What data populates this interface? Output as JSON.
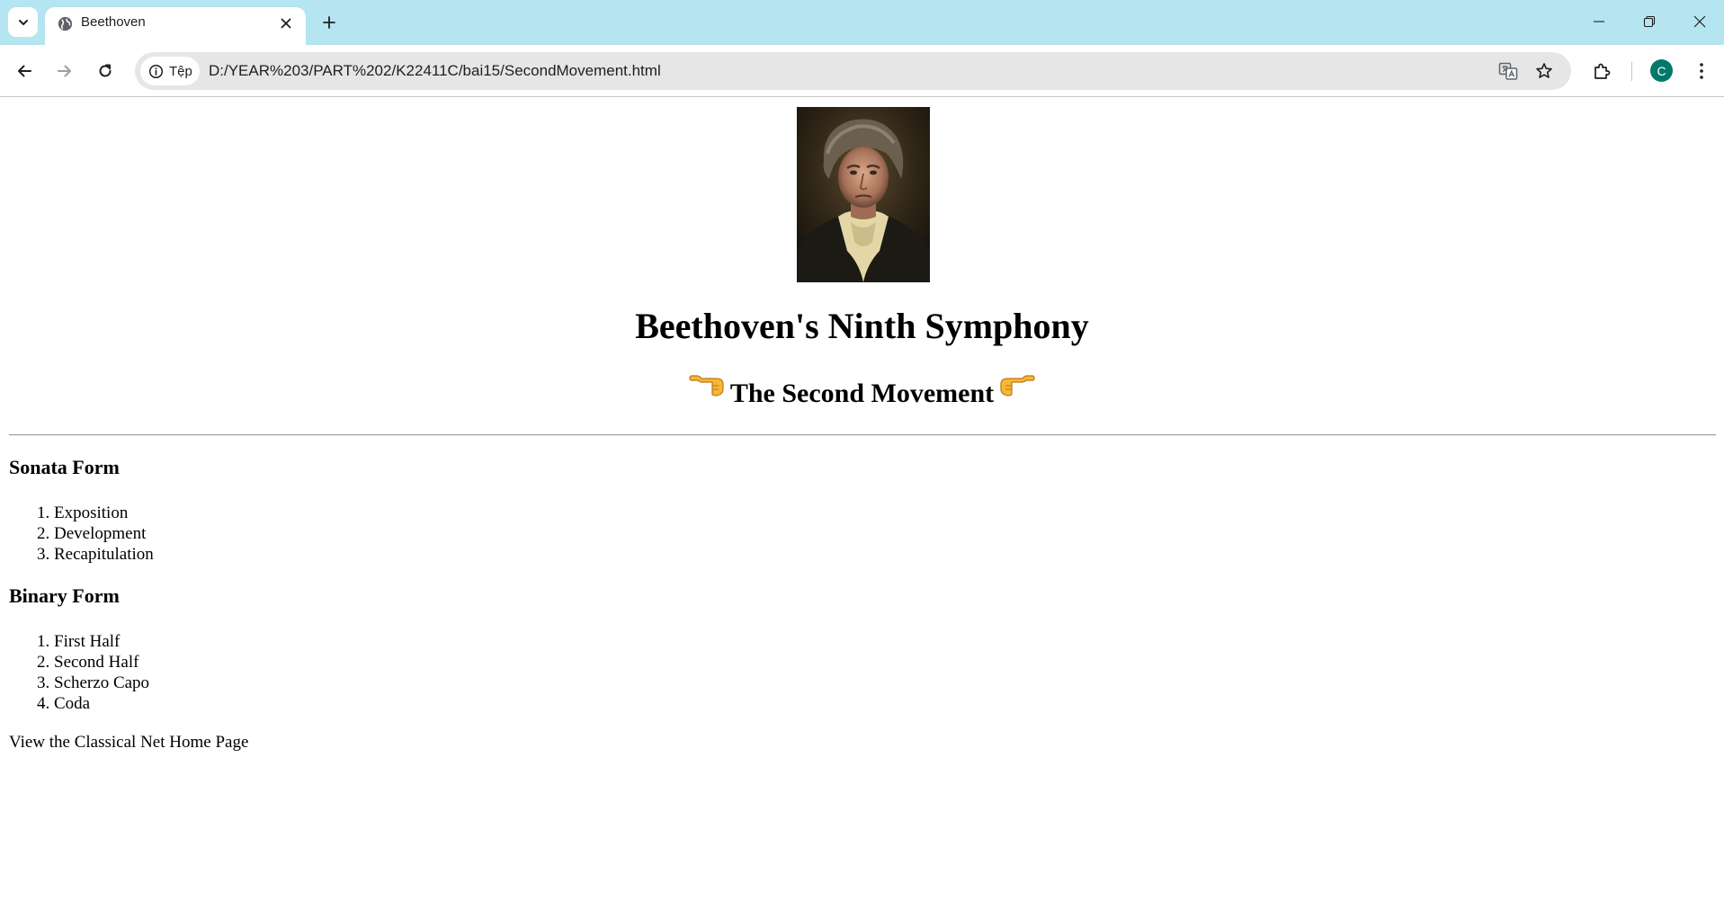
{
  "browser": {
    "tab": {
      "title": "Beethoven"
    },
    "address_bar": {
      "site_chip_label": "Tệp",
      "url": "D:/YEAR%203/PART%202/K22411C/bai15/SecondMovement.html"
    },
    "profile_initial": "C",
    "colors": {
      "tabstrip": "#b4e5f1",
      "omnibox": "#e6e6e6",
      "avatar": "#00796b"
    },
    "icons": {
      "tab_search": "chevron-down-icon",
      "favicon": "globe-icon",
      "tab_close": "close-icon",
      "new_tab": "plus-icon",
      "back": "arrow-left-icon",
      "forward": "arrow-right-icon",
      "reload": "reload-icon",
      "site_info": "info-icon",
      "translate": "translate-icon",
      "bookmark": "star-icon",
      "extensions": "puzzle-icon",
      "menu": "kebab-menu-icon",
      "minimize": "minimize-icon",
      "restore": "restore-icon",
      "close_window": "close-window-icon"
    }
  },
  "page": {
    "title": "Beethoven's Ninth Symphony",
    "subtitle": "The Second Movement",
    "subtitle_left_emoji": "👈",
    "subtitle_right_emoji": "👉",
    "sections": [
      {
        "heading": "Sonata Form",
        "items": [
          "Exposition",
          "Development",
          "Recapitulation"
        ]
      },
      {
        "heading": "Binary Form",
        "items": [
          "First Half",
          "Second Half",
          "Scherzo Capo",
          "Coda"
        ]
      }
    ],
    "home_link": "View the Classical Net Home Page"
  }
}
